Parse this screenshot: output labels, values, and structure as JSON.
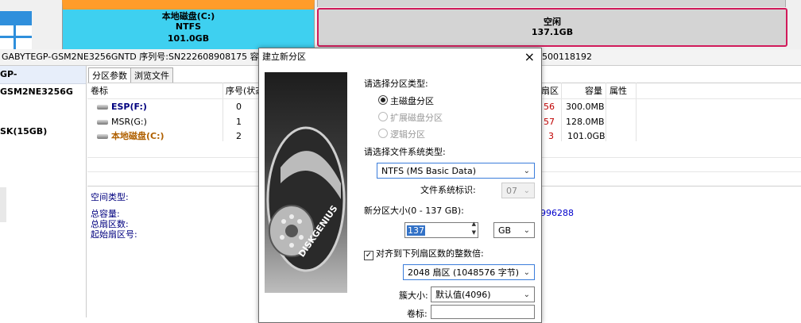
{
  "diskmap": {
    "partition_label": "本地磁盘(C:)",
    "partition_fs": "NTFS",
    "partition_size": "101.0GB",
    "free_label": "空闲",
    "free_size": "137.1GB"
  },
  "infobar": {
    "text_left": "GABYTEGP-GSM2NE3256GNTD  序列号:SN222608908175  容量:",
    "text_right": "500118192"
  },
  "tree": {
    "disk_name": "GP-GSM2NE3256G",
    "sub_label": "SK(15GB)"
  },
  "tabs": [
    {
      "label": "分区参数"
    },
    {
      "label": "浏览文件"
    }
  ],
  "table": {
    "headers": {
      "vol": "卷标",
      "seq": "序号(状态",
      "hidden_col": "扇区",
      "cap": "容量",
      "attr": "属性"
    },
    "rows": [
      {
        "vol": "ESP(F:)",
        "seq": "0",
        "hidden": "56",
        "cap": "300.0MB"
      },
      {
        "vol": "MSR(G:)",
        "seq": "1",
        "hidden": "57",
        "cap": "128.0MB"
      },
      {
        "vol": "本地磁盘(C:)",
        "seq": "2",
        "hidden": "3",
        "cap": "101.0GB"
      }
    ]
  },
  "details": {
    "type_label": "空间类型:",
    "total_cap": "总容量:",
    "total_sectors": "总扇区数:",
    "start_sector": "起始扇区号:",
    "right_value": "996288"
  },
  "dialog": {
    "title": "建立新分区",
    "close": "×",
    "brand": "DISKGENIUS",
    "select_type_label": "请选择分区类型:",
    "radio_primary": "主磁盘分区",
    "radio_extended": "扩展磁盘分区",
    "radio_logical": "逻辑分区",
    "fs_type_label": "请选择文件系统类型:",
    "fs_value": "NTFS (MS Basic Data)",
    "fs_id_label": "文件系统标识:",
    "fs_id_value": "07",
    "size_label": "新分区大小(0 - 137 GB):",
    "size_value": "137",
    "size_unit": "GB",
    "align_label": "对齐到下列扇区数的整数倍:",
    "align_value": "2048 扇区 (1048576 字节)",
    "cluster_label": "簇大小:",
    "cluster_value": "默认值(4096)",
    "volume_label": "卷标:"
  }
}
